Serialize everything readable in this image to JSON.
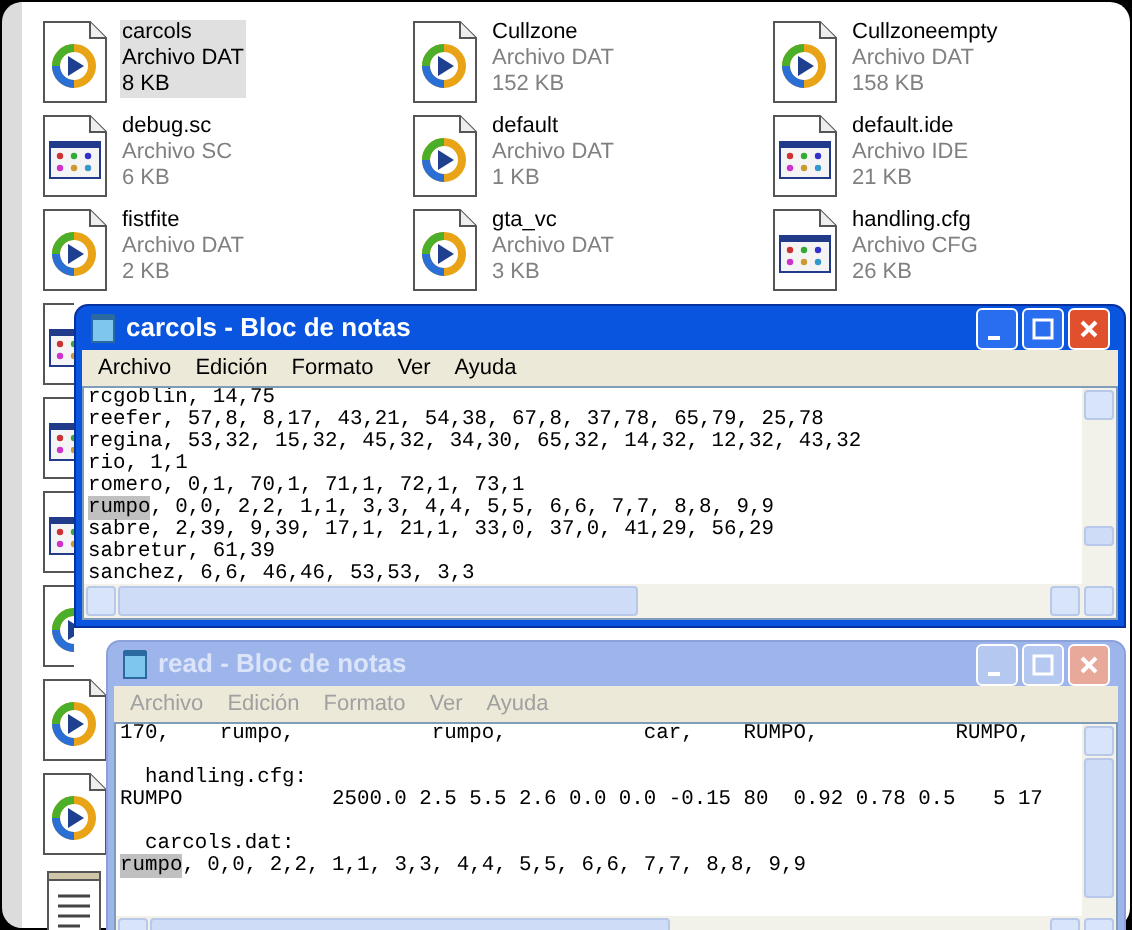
{
  "files": [
    {
      "name": "carcols",
      "type": "Archivo DAT",
      "size": "8 KB",
      "kind": "dat",
      "selected": true
    },
    {
      "name": "Cullzone",
      "type": "Archivo DAT",
      "size": "152 KB",
      "kind": "dat",
      "selected": false
    },
    {
      "name": "Cullzoneempty",
      "type": "Archivo DAT",
      "size": "158 KB",
      "kind": "dat",
      "selected": false
    },
    {
      "name": "debug.sc",
      "type": "Archivo SC",
      "size": "6 KB",
      "kind": "config",
      "selected": false
    },
    {
      "name": "default",
      "type": "Archivo DAT",
      "size": "1 KB",
      "kind": "dat",
      "selected": false
    },
    {
      "name": "default.ide",
      "type": "Archivo IDE",
      "size": "21 KB",
      "kind": "config",
      "selected": false
    },
    {
      "name": "fistfite",
      "type": "Archivo DAT",
      "size": "2 KB",
      "kind": "dat",
      "selected": false
    },
    {
      "name": "gta_vc",
      "type": "Archivo DAT",
      "size": "3 KB",
      "kind": "dat",
      "selected": false
    },
    {
      "name": "handling.cfg",
      "type": "Archivo CFG",
      "size": "26 KB",
      "kind": "config",
      "selected": false
    }
  ],
  "covered_files": [
    {
      "kind": "config"
    },
    {
      "kind": "config"
    },
    {
      "kind": "config"
    },
    {
      "kind": "dat"
    },
    {
      "kind": "dat"
    },
    {
      "kind": "dat"
    },
    {
      "kind": "text"
    }
  ],
  "windows": [
    {
      "title": "carcols - Bloc de notas",
      "active": true,
      "menu": [
        "Archivo",
        "Edición",
        "Formato",
        "Ver",
        "Ayuda"
      ],
      "lines": [
        {
          "kind": "text",
          "segments": [
            {
              "text": "rcgoblin, 14,75",
              "selected": false
            }
          ]
        },
        {
          "kind": "text",
          "segments": [
            {
              "text": "reefer, 57,8, 8,17, 43,21, 54,38, 67,8, 37,78, 65,79, 25,78",
              "selected": false
            }
          ]
        },
        {
          "kind": "text",
          "segments": [
            {
              "text": "regina, 53,32, 15,32, 45,32, 34,30, 65,32, 14,32, 12,32, 43,32",
              "selected": false
            }
          ]
        },
        {
          "kind": "text",
          "segments": [
            {
              "text": "rio, 1,1",
              "selected": false
            }
          ]
        },
        {
          "kind": "text",
          "segments": [
            {
              "text": "romero, 0,1, 70,1, 71,1, 72,1, 73,1",
              "selected": false
            }
          ]
        },
        {
          "kind": "text",
          "segments": [
            {
              "text": "rumpo",
              "selected": true
            },
            {
              "text": ", 0,0, 2,2, 1,1, 3,3, 4,4, 5,5, 6,6, 7,7, 8,8, 9,9",
              "selected": false
            }
          ]
        },
        {
          "kind": "text",
          "segments": [
            {
              "text": "sabre, 2,39, 9,39, 17,1, 21,1, 33,0, 37,0, 41,29, 56,29",
              "selected": false
            }
          ]
        },
        {
          "kind": "text",
          "segments": [
            {
              "text": "sabretur, 61,39",
              "selected": false
            }
          ]
        },
        {
          "kind": "text",
          "segments": [
            {
              "text": "sanchez, 6,6, 46,46, 53,53, 3,3",
              "selected": false
            }
          ]
        }
      ]
    },
    {
      "title": "read - Bloc de notas",
      "active": false,
      "menu": [
        "Archivo",
        "Edición",
        "Formato",
        "Ver",
        "Ayuda"
      ],
      "lines": [
        {
          "kind": "text",
          "segments": [
            {
              "text": "170,    rumpo,           rumpo,           car,    RUMPO,           RUMPO,",
              "selected": false
            }
          ]
        },
        {
          "kind": "blank"
        },
        {
          "kind": "text",
          "segments": [
            {
              "text": "  handling.cfg:",
              "selected": false
            }
          ]
        },
        {
          "kind": "text",
          "segments": [
            {
              "text": "RUMPO            2500.0 2.5 5.5 2.6 0.0 0.0 -0.15 80  0.92 0.78 0.5   5 17",
              "selected": false
            }
          ]
        },
        {
          "kind": "blank"
        },
        {
          "kind": "text",
          "segments": [
            {
              "text": "  carcols.dat:",
              "selected": false
            }
          ]
        },
        {
          "kind": "text",
          "segments": [
            {
              "text": "rumpo",
              "selected": true
            },
            {
              "text": ", 0,0, 2,2, 1,1, 3,3, 4,4, 5,5, 6,6, 7,7, 8,8, 9,9",
              "selected": false
            }
          ]
        }
      ]
    }
  ]
}
